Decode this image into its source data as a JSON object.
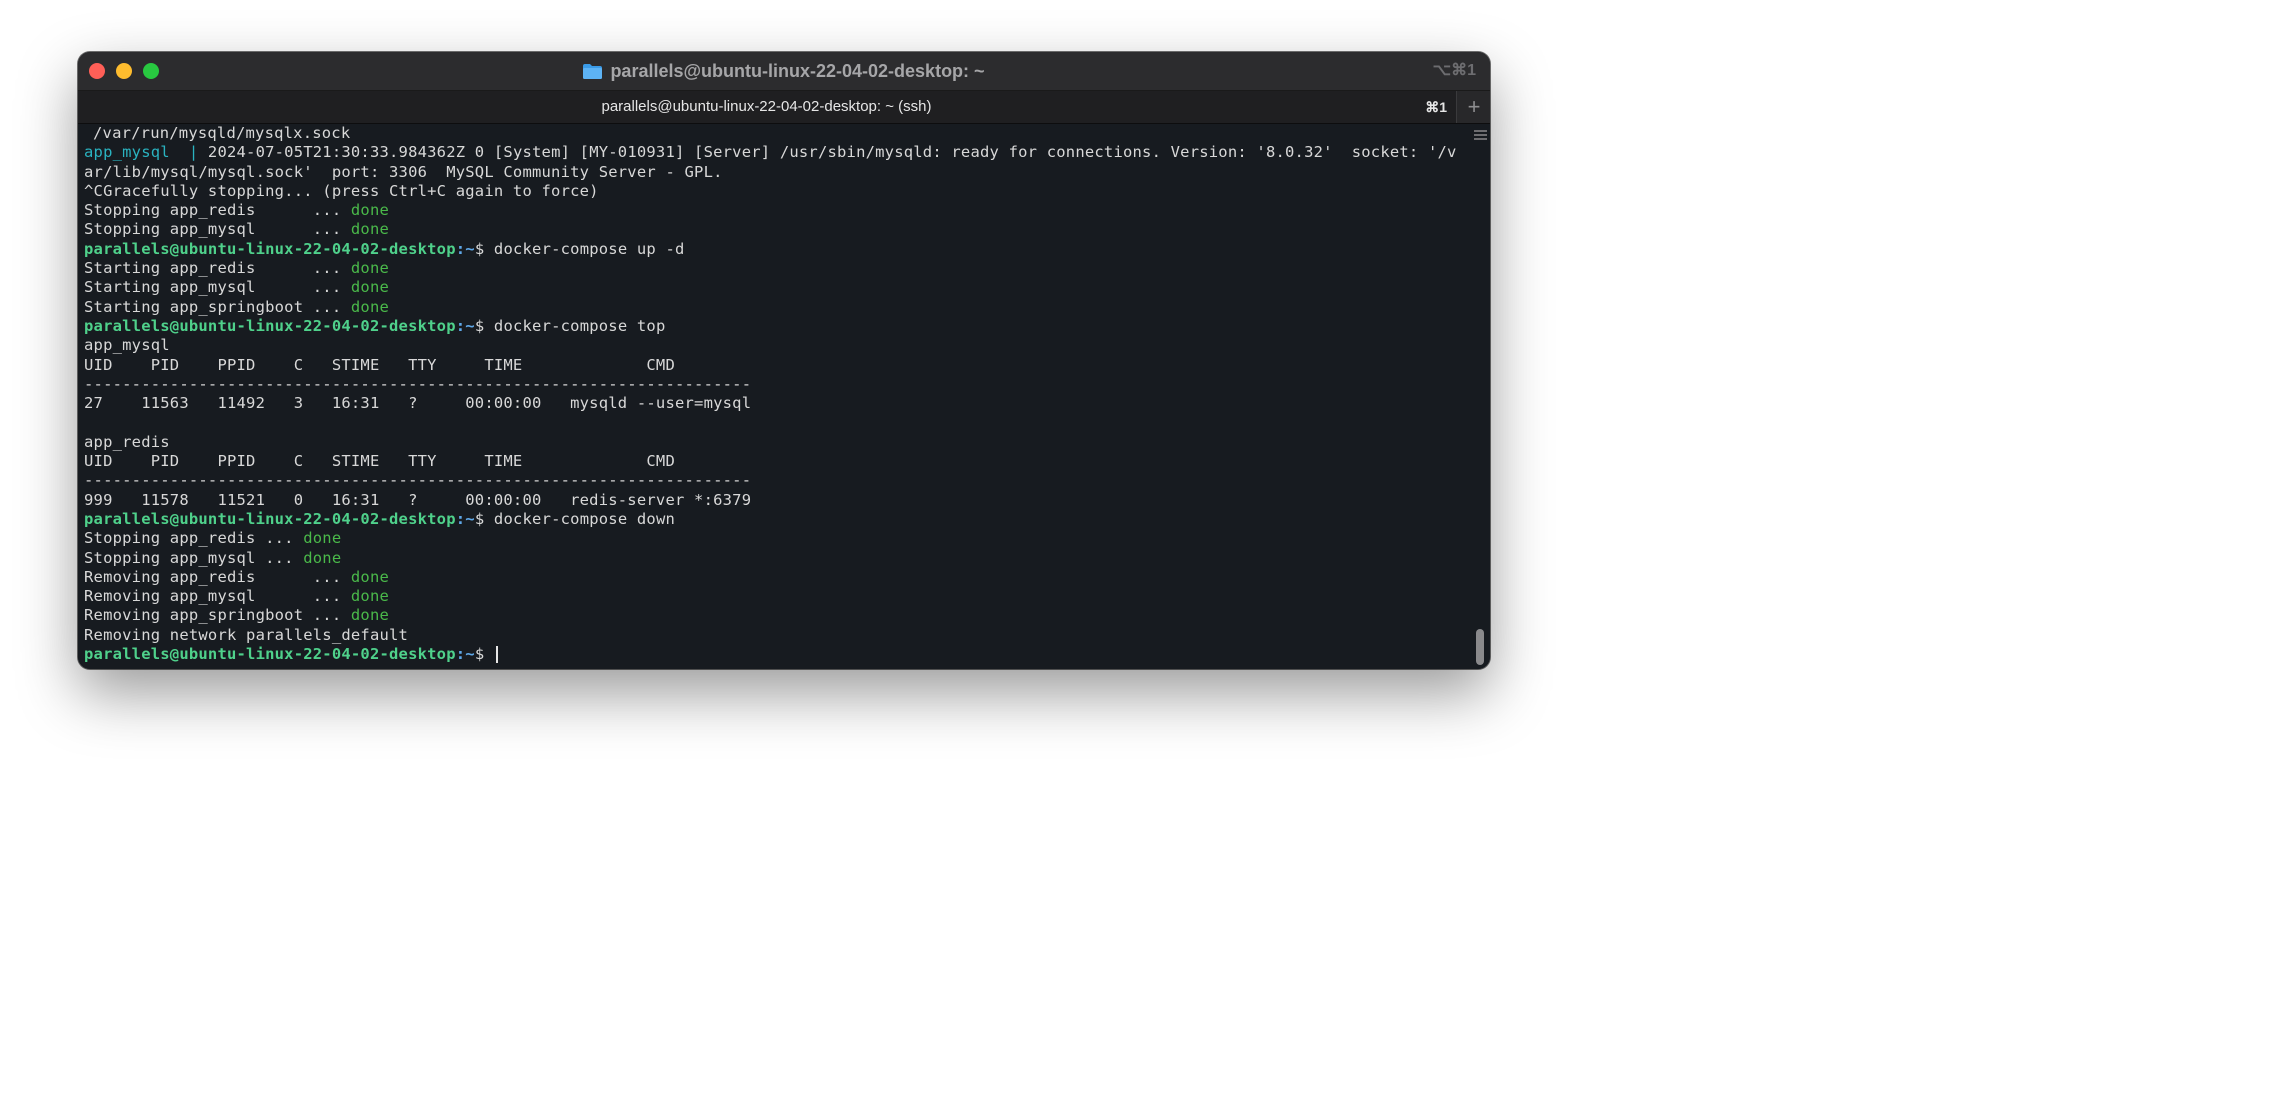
{
  "window": {
    "title": "parallels@ubuntu-linux-22-04-02-desktop: ~",
    "shortcut": "⌥⌘1",
    "folder_icon": "folder-icon"
  },
  "tab": {
    "title": "parallels@ubuntu-linux-22-04-02-desktop: ~ (ssh)",
    "shortcut": "⌘1",
    "new_tab_label": "+"
  },
  "terminal": {
    "prompt_user": "parallels@ubuntu-linux-22-04-02-desktop",
    "prompt_sep": ":",
    "prompt_path": "~",
    "prompt_symbol": "$ ",
    "lines": {
      "l0": "/var/run/mysqld/mysqlx.sock",
      "l1_prefix": "app_mysql  | ",
      "l1_text": "2024-07-05T21:30:33.984362Z 0 [System] [MY-010931] [Server] /usr/sbin/mysqld: ready for connections. Version: '8.0.32'  socket: '/v",
      "l2": "ar/lib/mysql/mysql.sock'  port: 3306  MySQL Community Server - GPL.",
      "l3": "^CGracefully stopping... (press Ctrl+C again to force)",
      "l4_text": "Stopping app_redis      ... ",
      "l5_text": "Stopping app_mysql      ... ",
      "done": "done",
      "cmd_up": "docker-compose up -d",
      "l7_text": "Starting app_redis      ... ",
      "l8_text": "Starting app_mysql      ... ",
      "l9_text": "Starting app_springboot ... ",
      "cmd_top": "docker-compose top",
      "mysql_name": "app_mysql",
      "table_header": "UID    PID    PPID    C   STIME   TTY     TIME             CMD",
      "table_rule": "----------------------------------------------------------------------",
      "mysql_row": "27    11563   11492   3   16:31   ?     00:00:00   mysqld --user=mysql",
      "redis_name": "app_redis",
      "redis_row": "999   11578   11521   0   16:31   ?     00:00:00   redis-server *:6379",
      "cmd_down": "docker-compose down",
      "d1_text": "Stopping app_redis ... ",
      "d2_text": "Stopping app_mysql ... ",
      "d3_text": "Removing app_redis      ... ",
      "d4_text": "Removing app_mysql      ... ",
      "d5_text": "Removing app_springboot ... ",
      "d6": "Removing network parallels_default"
    }
  },
  "colors": {
    "prompt_user": "#4fd18b",
    "prompt_path": "#5fa8e8",
    "done": "#4ab94a",
    "service_prefix": "#2ab3c0",
    "background": "#171b20"
  }
}
